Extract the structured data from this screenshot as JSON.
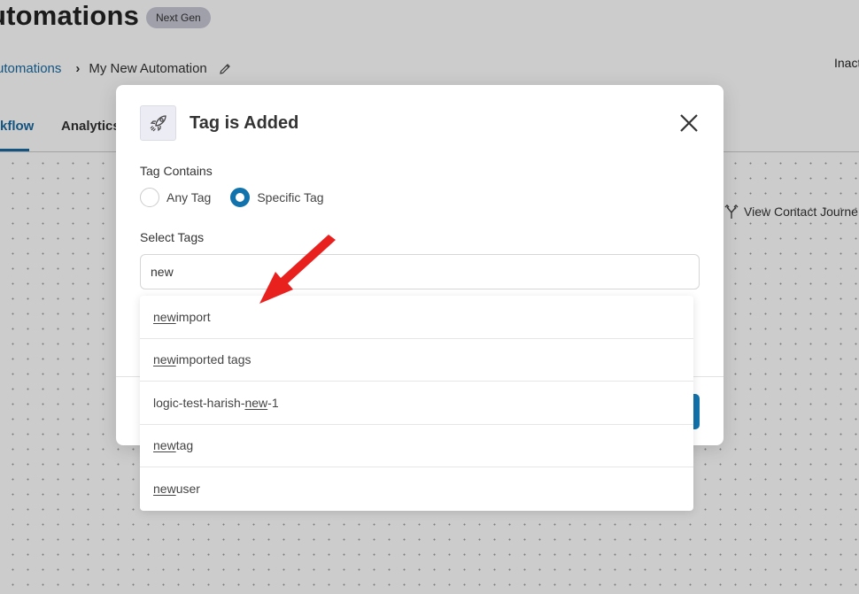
{
  "page": {
    "title": "utomations",
    "badge": "Next Gen",
    "breadcrumb": {
      "parent": "utomations",
      "current": "My New Automation"
    },
    "status": "Inact",
    "tabs": [
      {
        "label": "kflow",
        "active": true
      },
      {
        "label": "Analytics",
        "active": false
      }
    ],
    "journey_button": "View Contact Journe"
  },
  "modal": {
    "title": "Tag is Added",
    "icon": "rocket-icon",
    "tag_contains_label": "Tag Contains",
    "radio_options": [
      {
        "label": "Any Tag",
        "checked": false
      },
      {
        "label": "Specific Tag",
        "checked": true
      }
    ],
    "select_tags_label": "Select Tags",
    "search_value": "new",
    "accent_color": "#1273ac"
  },
  "dropdown": {
    "items": [
      {
        "before": "",
        "match": "new",
        "after": " import"
      },
      {
        "before": "",
        "match": "new",
        "after": " imported tags"
      },
      {
        "before": "logic-test-harish-",
        "match": "new",
        "after": "-1"
      },
      {
        "before": "",
        "match": "new",
        "after": " tag"
      },
      {
        "before": "",
        "match": "new",
        "after": " user"
      }
    ]
  },
  "annotation": {
    "arrow_color": "#e8211f"
  }
}
